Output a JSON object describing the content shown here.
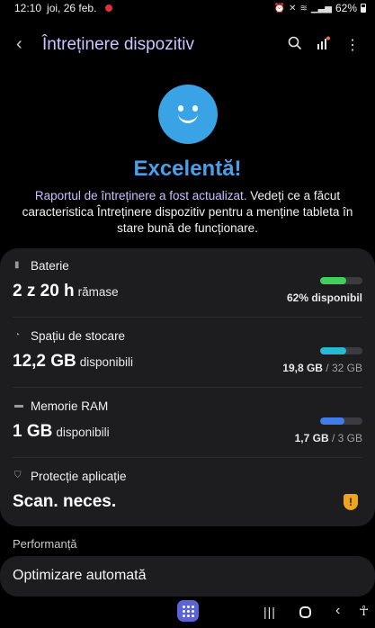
{
  "statusbar": {
    "time": "12:10",
    "date": "joi, 26 feb.",
    "battery": "62%"
  },
  "appbar": {
    "title": "Întreținere dispozitiv"
  },
  "summary": {
    "status": "Excelentă!",
    "report_link": "Raportul de întreținere a fost actualizat.",
    "report_text": " Vedeți ce a făcut caracteristica Întreținere dispozitiv pentru a menține tableta în stare bună de funcționare."
  },
  "battery": {
    "label": "Baterie",
    "value": "2 z 20 h",
    "unit": "rămase",
    "meta": "62% disponibil",
    "fill": 62,
    "color": "#3fcf5a"
  },
  "storage": {
    "label": "Spațiu de stocare",
    "value": "12,2 GB",
    "unit": "disponibili",
    "used": "19,8 GB",
    "total": " / 32 GB",
    "fill": 62,
    "color": "#28b8d6"
  },
  "ram": {
    "label": "Memorie RAM",
    "value": "1 GB",
    "unit": "disponibili",
    "used": "1,7 GB",
    "total": " / 3 GB",
    "fill": 57,
    "color": "#3f7ee8"
  },
  "protection": {
    "label": "Protecție aplicație",
    "value": "Scan. neces."
  },
  "performance": {
    "section_title": "Performanță",
    "auto_optimize": "Optimizare automată"
  }
}
